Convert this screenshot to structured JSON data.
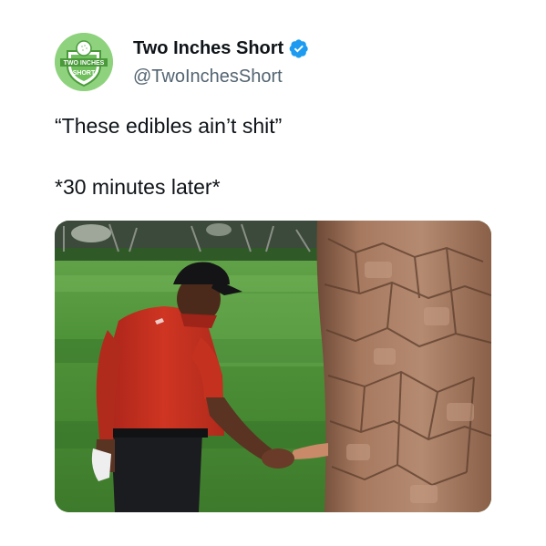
{
  "account": {
    "display_name": "Two Inches Short",
    "handle": "@TwoInchesShort",
    "avatar_text_top": "TWO INCHES",
    "avatar_text_bottom": "SHORT",
    "verified": true
  },
  "tweet": {
    "line_1": "“These edibles ain’t shit”",
    "line_2": "*30 minutes later*"
  },
  "media": {
    "type": "photo"
  },
  "colors": {
    "text": "#0f1419",
    "handle": "#536471",
    "verified_badge": "#1d9bf0",
    "avatar_bg": "#8fd27e",
    "shirt": "#c8301e",
    "grass": "#4c8d38",
    "bark": "#9a6c52"
  }
}
